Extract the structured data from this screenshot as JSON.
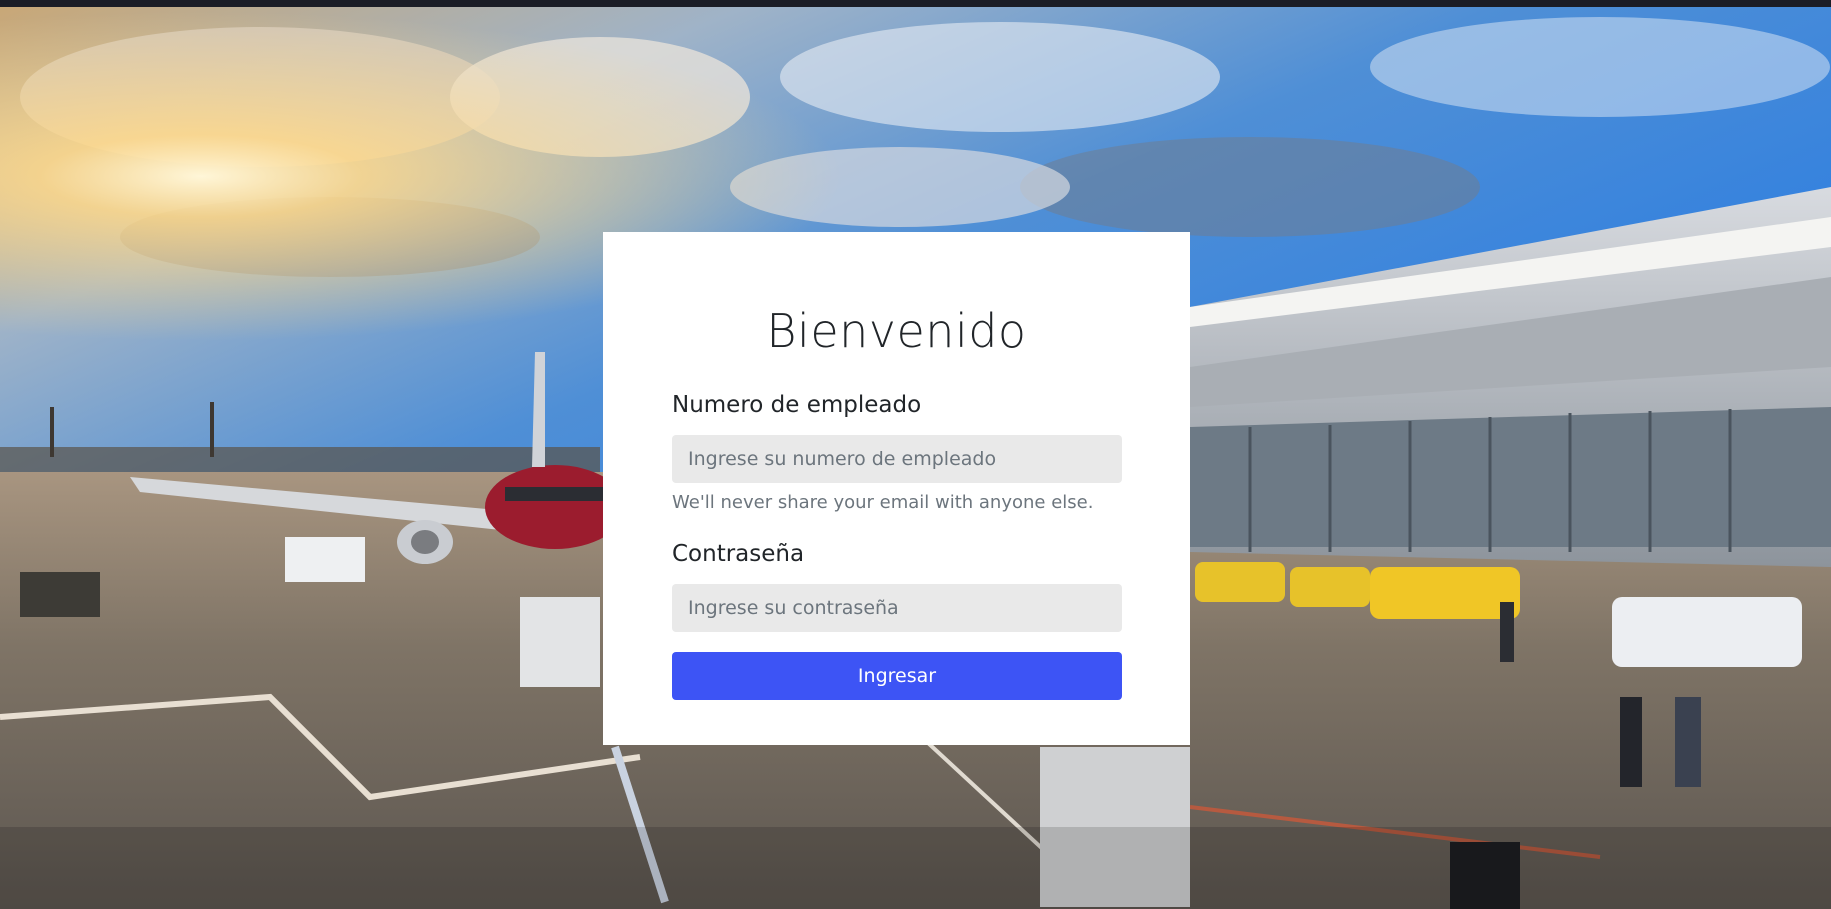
{
  "login": {
    "title": "Bienvenido",
    "employee_label": "Numero de empleado",
    "employee_placeholder": "Ingrese su numero de empleado",
    "employee_value": "",
    "employee_help": "We'll never share your email with anyone else.",
    "password_label": "Contraseña",
    "password_placeholder": "Ingrese su contraseña",
    "password_value": "",
    "submit_label": "Ingresar"
  },
  "colors": {
    "accent": "#3d54f5",
    "card": "#ffffff",
    "input_bg": "#e9e9e9",
    "help_text": "#6c757d"
  }
}
